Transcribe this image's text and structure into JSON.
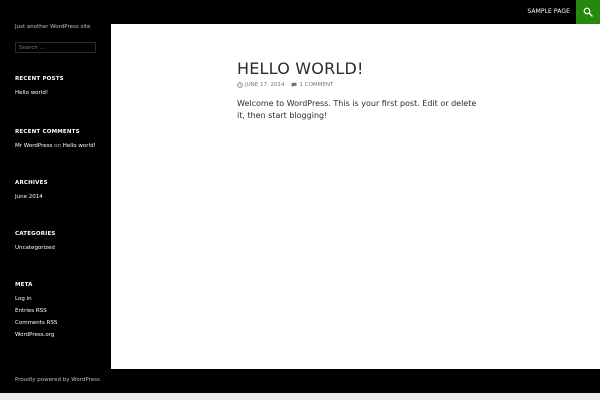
{
  "header": {
    "nav_items": [
      "SAMPLE PAGE"
    ],
    "search_icon": "search-icon",
    "accent_color": "#24890d"
  },
  "sidebar": {
    "site_description": "Just another WordPress site",
    "search_placeholder": "Search ...",
    "widgets": {
      "recent_posts": {
        "title": "RECENT POSTS",
        "items": [
          "Hello world!"
        ]
      },
      "recent_comments": {
        "title": "RECENT COMMENTS",
        "author": "Mr WordPress",
        "on": "on",
        "post": "Hello world!"
      },
      "archives": {
        "title": "ARCHIVES",
        "items": [
          "June 2014"
        ]
      },
      "categories": {
        "title": "CATEGORIES",
        "items": [
          "Uncategorized"
        ]
      },
      "meta": {
        "title": "META",
        "items": [
          "Log in",
          "Entries RSS",
          "Comments RSS",
          "WordPress.org"
        ]
      }
    }
  },
  "post": {
    "title": "HELLO WORLD!",
    "date": "JUNE 17, 2014",
    "date_icon": "clock-icon",
    "comments": "1 COMMENT",
    "comments_icon": "comment-icon",
    "content": "Welcome to WordPress. This is your first post. Edit or delete it, then start blogging!"
  },
  "footer": {
    "credit": "Proudly powered by WordPress"
  }
}
